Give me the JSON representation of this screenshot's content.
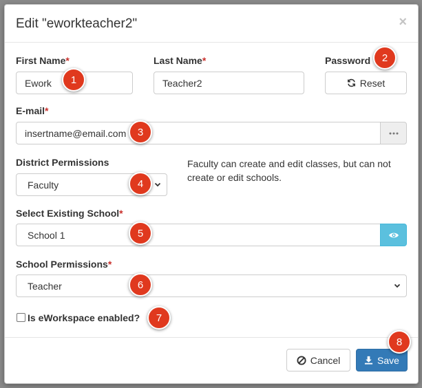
{
  "modal": {
    "title": "Edit \"eworkteacher2\"",
    "close_symbol": "×"
  },
  "form": {
    "first_name": {
      "label": "First Name",
      "required": "*",
      "value": "Ework"
    },
    "last_name": {
      "label": "Last Name",
      "required": "*",
      "value": "Teacher2"
    },
    "password": {
      "label": "Password",
      "reset_label": "Reset",
      "icon": "refresh-icon"
    },
    "email": {
      "label": "E-mail",
      "required": "*",
      "value": "insertname@email.com",
      "addon_icon": "ellipsis-icon"
    },
    "district_permissions": {
      "label": "District Permissions",
      "selected": "Faculty",
      "help": "Faculty can create and edit classes, but can not create or edit schools."
    },
    "school": {
      "label": "Select Existing School",
      "required": "*",
      "value": "School 1",
      "addon_icon": "eye-icon"
    },
    "school_permissions": {
      "label": "School Permissions",
      "required": "*",
      "selected": "Teacher"
    },
    "eworkspace": {
      "label": "Is eWorkspace enabled?",
      "checked": false
    }
  },
  "footer": {
    "cancel_label": "Cancel",
    "save_label": "Save"
  },
  "badges": [
    "1",
    "2",
    "3",
    "4",
    "5",
    "6",
    "7",
    "8"
  ],
  "colors": {
    "badge": "#e0391e",
    "primary": "#337ab7",
    "info_addon": "#5bc0de",
    "required": "#c9302c"
  }
}
